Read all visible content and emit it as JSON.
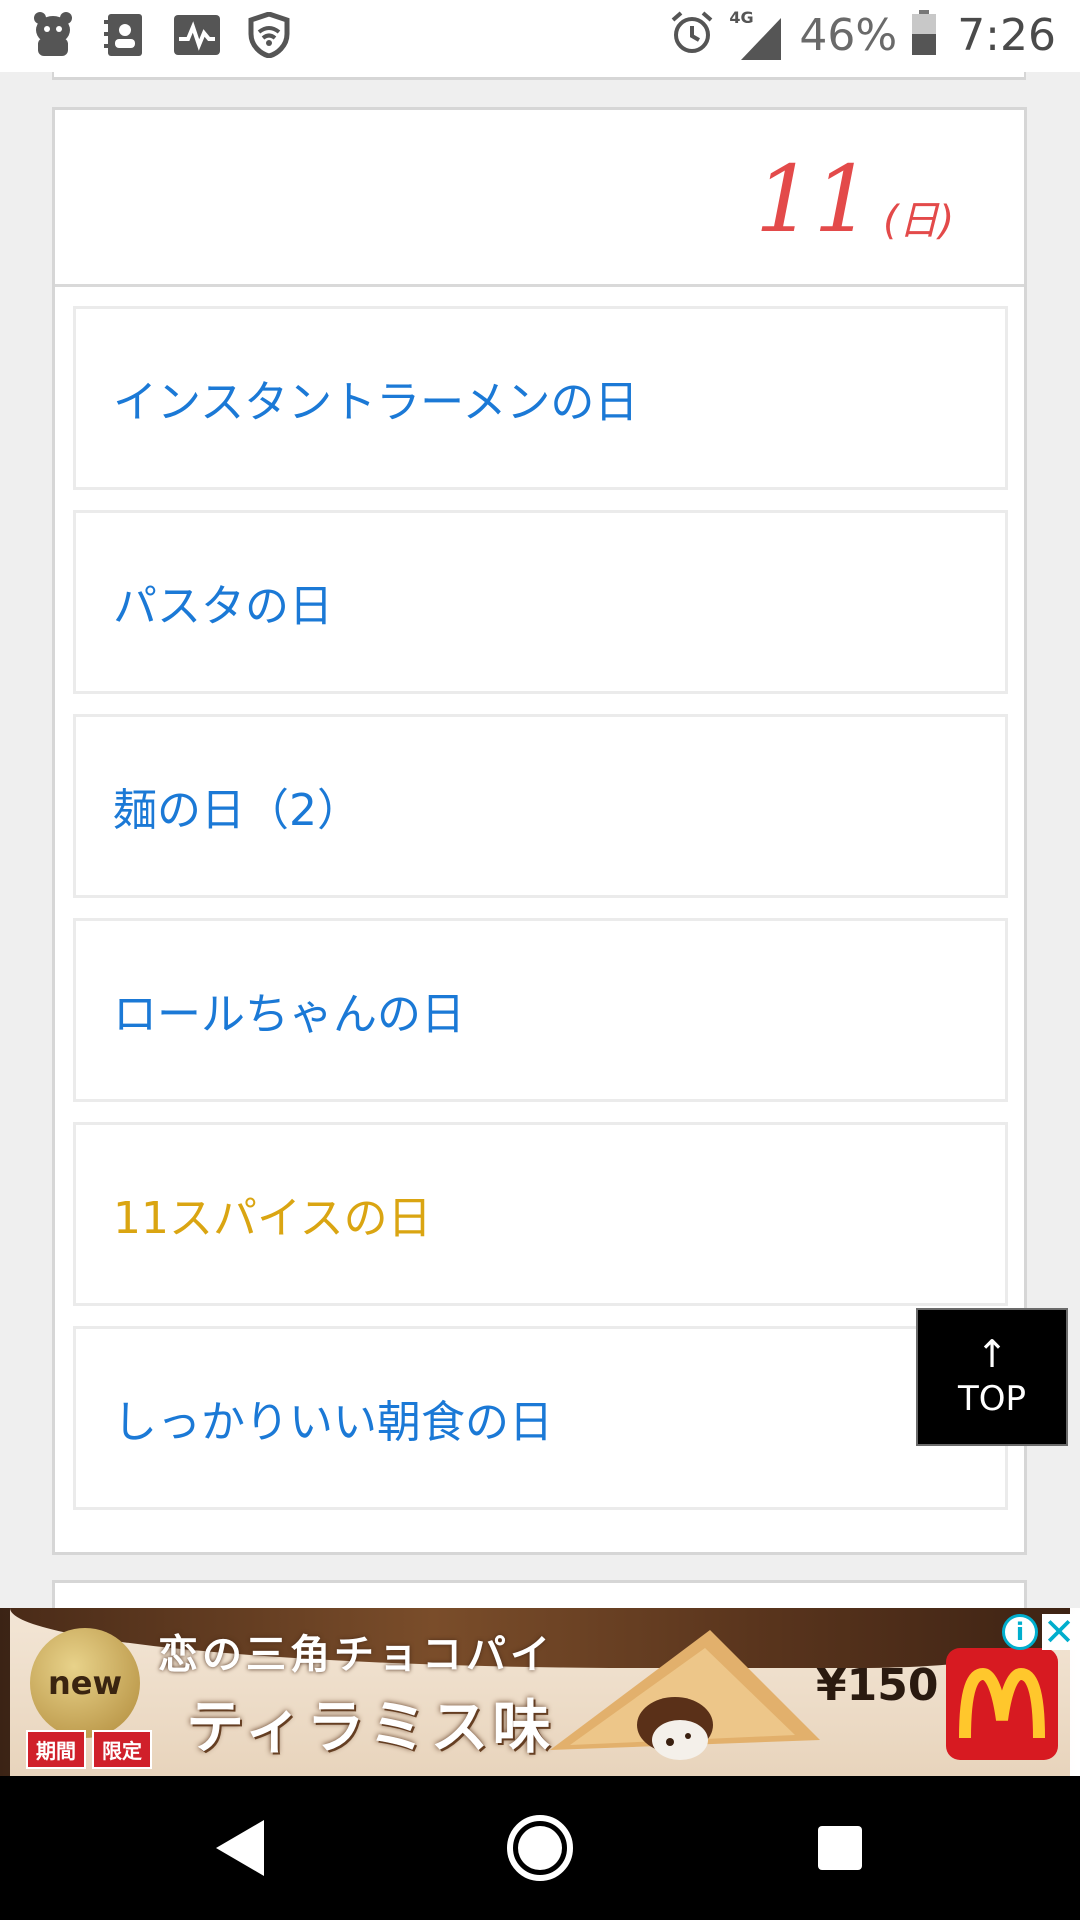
{
  "status_bar": {
    "network": "4G",
    "battery": "46%",
    "time": "7:26"
  },
  "day_header": {
    "day_number": "11",
    "weekday": "(日)"
  },
  "items": [
    {
      "label": "インスタントラーメンの日"
    },
    {
      "label": "パスタの日"
    },
    {
      "label": "麺の日（2）"
    },
    {
      "label": "ロールちゃんの日"
    },
    {
      "label": "11スパイスの日"
    },
    {
      "label": "しっかりいい朝食の日"
    }
  ],
  "top_button": {
    "arrow": "↑",
    "label": "TOP"
  },
  "ad": {
    "badge": "new",
    "title_line1": "恋の三角チョコパイ",
    "title_line2": "ティラミス味",
    "limited_1": "期間",
    "limited_2": "限定",
    "price": "¥150",
    "info": "i",
    "close": "✕"
  },
  "colors": {
    "link": "#1b79d6",
    "link_highlight": "#daa512",
    "day_red": "#e34a4a"
  }
}
